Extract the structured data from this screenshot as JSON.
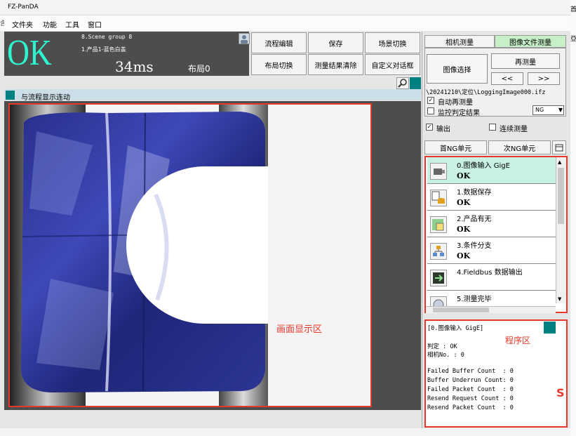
{
  "window": {
    "title": "FZ-PanDA"
  },
  "menu": {
    "items": [
      "文件夹",
      "功能",
      "工具",
      "窗口"
    ]
  },
  "desktop": {
    "left_edge": "含",
    "right_top": "首",
    "right_second": "亞"
  },
  "status": {
    "judgement": "OK",
    "scene_group": "8.Scene group 8",
    "scene_name": "1.产品1-蓝色白盖",
    "time": "34ms",
    "layout": "布局0"
  },
  "toolbar": {
    "flow_edit": "流程编辑",
    "save": "保存",
    "scene_switch": "场景切换",
    "layout_switch": "布局切换",
    "clear_results": "测量结果清除",
    "custom_dialog": "自定义对话框"
  },
  "display": {
    "sync_label": "与流程显示连动",
    "area_label": "画面显示区"
  },
  "side_panel": {
    "tabs": [
      "相机测量",
      "图像文件测量"
    ],
    "image_select": "图像选择",
    "remeasure": "再测量",
    "prev": "<<",
    "next": ">>",
    "file_path": "\\20241210\\定位\\LoggingImage000.ifz",
    "auto_remeasure": "自动再测量",
    "monitor_result": "监控判定结果",
    "ng_option": "NG",
    "output": "输出",
    "continuous": "连续测量",
    "first_ng": "首NG单元",
    "next_ng": "次NG单元"
  },
  "flow": {
    "items": [
      {
        "name": "0.图像输入 GigE",
        "status": "OK",
        "icon": "camera-icon"
      },
      {
        "name": "1.数据保存",
        "status": "OK",
        "icon": "database-icon"
      },
      {
        "name": "2.产品有无",
        "status": "OK",
        "icon": "search-shape-icon"
      },
      {
        "name": "3.条件分支",
        "status": "OK",
        "icon": "branch-icon"
      },
      {
        "name": "4.Fieldbus 数据输出",
        "status": "",
        "icon": "output-icon"
      },
      {
        "name": "5.测量完毕",
        "status": "",
        "icon": "end-icon"
      }
    ]
  },
  "detail": {
    "title": "[0.图像输入 GigE]",
    "program_label": "程序区",
    "lines": [
      "判定 : OK",
      "相机No. : 0",
      "",
      "Failed Buffer Count  : 0",
      "Buffer Underrun Count: 0",
      "Failed Packet Count  : 0",
      "Resend Request Count : 0",
      "Resend Packet Count  : 0"
    ]
  },
  "colors": {
    "ok_text": "#2ef4cf",
    "annotation_red": "#e8382a",
    "active_flow": "#c8f0e4",
    "teal": "#008080"
  }
}
